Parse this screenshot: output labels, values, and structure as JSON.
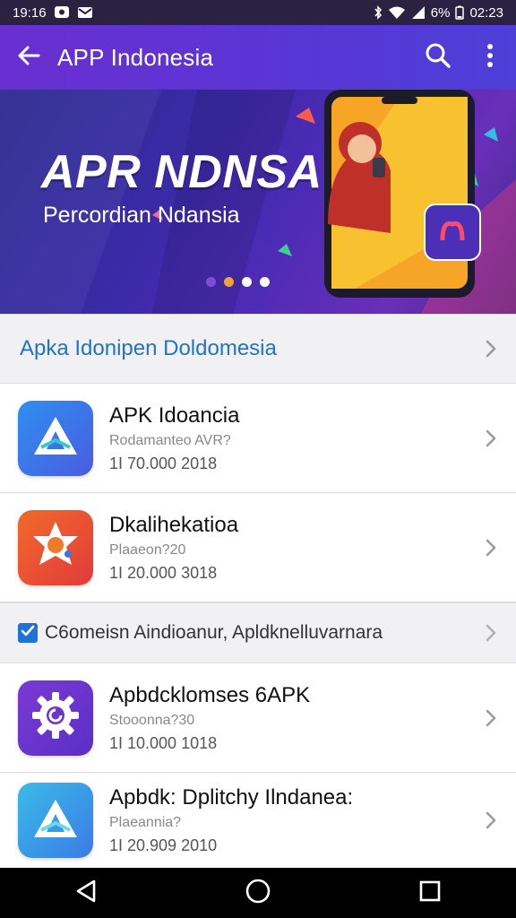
{
  "status_bar": {
    "time": "19:16",
    "battery": "6%",
    "clock_right": "02:23",
    "icons": [
      "message-icon",
      "mail-icon",
      "bluetooth-icon",
      "wifi-icon",
      "signal-icon"
    ]
  },
  "app_bar": {
    "title": "APP Indonesia",
    "back_icon": "arrow-left-icon",
    "search_icon": "search-icon",
    "menu_icon": "more-vert-icon"
  },
  "banner": {
    "headline": "APR NDNSA",
    "subline": "Percordian Ndansia",
    "slide_count": 4,
    "active_slide": 3,
    "dot_colors": [
      "#7b4fd8",
      "#f0a23a",
      "#ffffff",
      "#ffffff"
    ]
  },
  "section_header": {
    "label": "Apka Idonipen Doldomesia"
  },
  "apps": [
    {
      "name": "APK Idoancia",
      "sub": "Rodamanteo AVR?",
      "meta": "1I 70.000  2018",
      "icon": "triangle-a-icon",
      "icon_colors": [
        "#2f8ff0",
        "#4a5ce0"
      ]
    },
    {
      "name": "Dkalihekatioa",
      "sub": "Plaaeon?20",
      "meta": "1I 20.000  3018",
      "icon": "star-badge-icon",
      "icon_colors": [
        "#f06a2a",
        "#e23b3b"
      ]
    },
    {
      "name": "Apbdcklomses 6APK",
      "sub": "Stooonna?30",
      "meta": "1I 10.000  1018",
      "icon": "gear-icon",
      "icon_colors": [
        "#7a3ad6",
        "#5a2fc4"
      ]
    },
    {
      "name": "Apbdk: Dplitchy Ilndanea:",
      "sub": "Plaeannia?",
      "meta": "1I 20.909  2010",
      "icon": "triangle-a-icon",
      "icon_colors": [
        "#3bbbe8",
        "#3a7be6"
      ]
    }
  ],
  "section_checkbox": {
    "checked": true,
    "label": "C6omeisn Aindioanur, Apldknelluvarnara"
  },
  "nav_bar": {
    "back_icon": "nav-back-icon",
    "home_icon": "nav-home-icon",
    "recents_icon": "nav-recents-icon"
  }
}
